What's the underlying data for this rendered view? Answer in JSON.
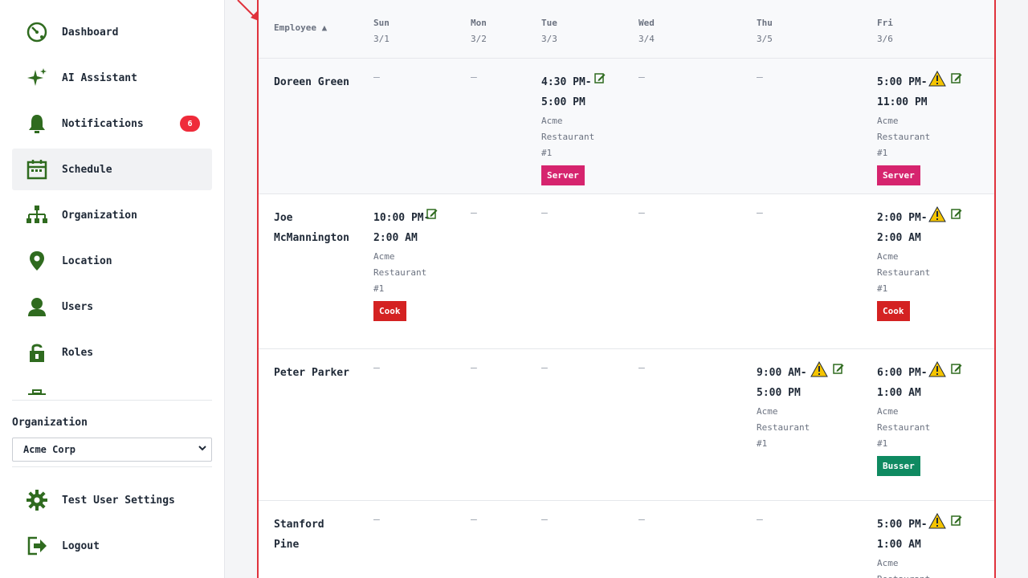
{
  "sidebar": {
    "items": [
      {
        "label": "Dashboard",
        "icon": "dashboard-icon"
      },
      {
        "label": "AI Assistant",
        "icon": "sparkle-icon"
      },
      {
        "label": "Notifications",
        "icon": "bell-icon",
        "badge": "6"
      },
      {
        "label": "Schedule",
        "icon": "calendar-icon",
        "active": true
      },
      {
        "label": "Organization",
        "icon": "org-chart-icon"
      },
      {
        "label": "Location",
        "icon": "location-pin-icon"
      },
      {
        "label": "Users",
        "icon": "user-icon"
      },
      {
        "label": "Roles",
        "icon": "lock-icon"
      }
    ],
    "org_label": "Organization",
    "org_selected": "Acme Corp",
    "settings_label": "Test User Settings",
    "logout_label": "Logout"
  },
  "colors": {
    "accent_green": "#2f6b1f",
    "badge_red": "#ef2b3a",
    "server": "#d6246e",
    "cook": "#d42222",
    "busser": "#0f8a61",
    "highlight_border": "#e0323c"
  },
  "table": {
    "employee_header": "Employee ▲",
    "days": [
      {
        "name": "Sun",
        "date": "3/1"
      },
      {
        "name": "Mon",
        "date": "3/2"
      },
      {
        "name": "Tue",
        "date": "3/3"
      },
      {
        "name": "Wed",
        "date": "3/4"
      },
      {
        "name": "Thu",
        "date": "3/5"
      },
      {
        "name": "Fri",
        "date": "3/6"
      }
    ],
    "empty": "—",
    "rows": [
      {
        "name": "Doreen Green",
        "tue": {
          "time": "4:30 PM-5:00 PM",
          "location": "Acme Restaurant #1",
          "role": "Server"
        },
        "fri": {
          "time": "5:00 PM-11:00 PM",
          "location": "Acme Restaurant #1",
          "role": "Server"
        }
      },
      {
        "name": "Joe McMannington",
        "sun": {
          "time": "10:00 PM-2:00 AM",
          "location": "Acme Restaurant #1",
          "role": "Cook"
        },
        "fri": {
          "time": "2:00 PM-2:00 AM",
          "location": "Acme Restaurant #1",
          "role": "Cook"
        }
      },
      {
        "name": "Peter Parker",
        "thu": {
          "time": "9:00 AM-5:00 PM",
          "location": "Acme Restaurant #1"
        },
        "fri": {
          "time": "6:00 PM-1:00 AM",
          "location": "Acme Restaurant #1",
          "role": "Busser"
        }
      },
      {
        "name": "Stanford Pine",
        "fri": {
          "time": "5:00 PM-1:00 AM",
          "location": "Acme Restaurant"
        }
      }
    ]
  }
}
